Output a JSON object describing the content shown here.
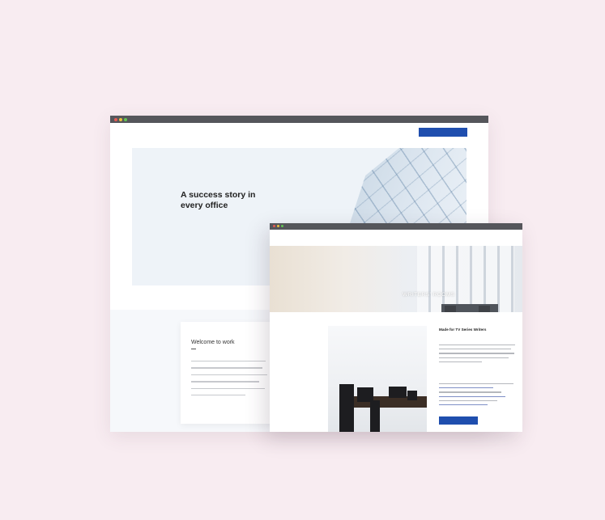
{
  "colors": {
    "background": "#f8ecf1",
    "brand_blue": "#1f4eae",
    "chrome": "#55565b"
  },
  "back_window": {
    "logo": "",
    "logo_sub": "",
    "nav_links": [],
    "cta_label": "",
    "hero": {
      "title": "A success story in every office",
      "subtitle": ""
    },
    "welcome_card": {
      "title": "Welcome to work"
    }
  },
  "front_window": {
    "logo": "",
    "nav_links": [],
    "hero": {
      "title": "WRITERS' ROOMS",
      "subtitle": ""
    },
    "section_title": "Made for TV Series Writers",
    "subheading": "",
    "cta_label": ""
  }
}
